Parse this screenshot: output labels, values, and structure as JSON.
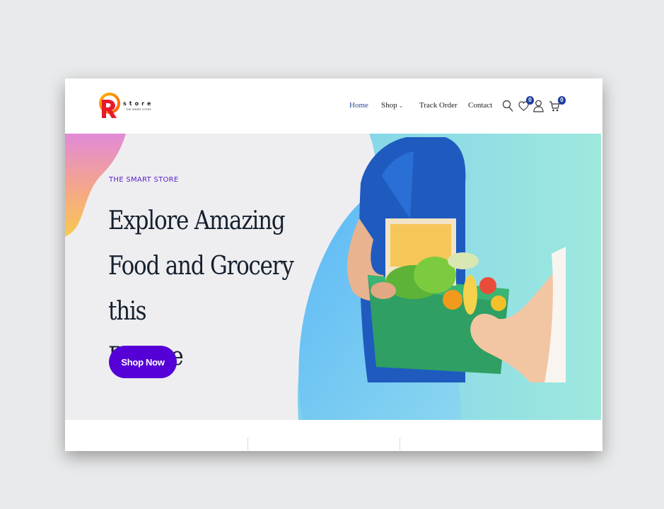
{
  "brand": {
    "name": "store",
    "tagline": "THE SMART STORE",
    "colors": {
      "accent": "#5400d6",
      "nav_active": "#2b4a9a",
      "badge": "#1e3fa0"
    }
  },
  "nav": {
    "items": [
      {
        "label": "Home"
      },
      {
        "label": "Shop"
      },
      {
        "label": "Track Order"
      },
      {
        "label": "Contact"
      }
    ]
  },
  "header_icons": {
    "search": "search-icon",
    "wishlist": "heart-icon",
    "wishlist_count": "0",
    "account": "user-icon",
    "cart": "cart-icon",
    "cart_count": "0"
  },
  "hero": {
    "kicker": "THE SMART STORE",
    "headline_line1": "Explore Amazing",
    "headline_line2": "Food and Grocery this",
    "headline_line3": "R-store",
    "cta_label": "Shop Now"
  }
}
